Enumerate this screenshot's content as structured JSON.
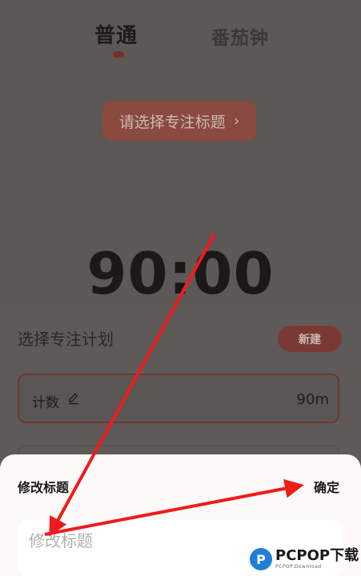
{
  "tabs": {
    "active_label": "普通",
    "inactive_label": "番茄钟"
  },
  "focus_title_button": {
    "label": "请选择专注标题",
    "chevron": "›"
  },
  "timer": {
    "display": "90:00"
  },
  "plan_panel": {
    "heading": "选择专注计划",
    "new_button_label": "新建",
    "plans": [
      {
        "name": "计数",
        "duration": "90m"
      }
    ]
  },
  "modal": {
    "title": "修改标题",
    "confirm_label": "确定",
    "input_placeholder": "修改标题",
    "input_value": ""
  },
  "annotations": {
    "arrow_color": "#ee1c1c"
  },
  "watermark": {
    "logo_letter": "P",
    "brand": "PCPOP下载",
    "sub": "PCPOP.Download"
  },
  "colors": {
    "overlay_background": "#5b5856",
    "accent": "#8a4a40",
    "sheet_background": "#fdf9f8"
  }
}
